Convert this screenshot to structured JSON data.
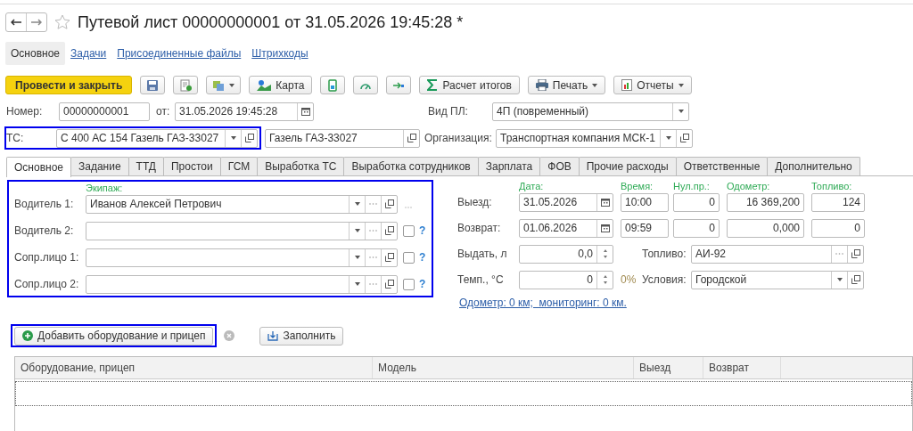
{
  "title": "Путевой лист 00000000001 от 31.05.2026 19:45:28 *",
  "sections": [
    {
      "label": "Основное",
      "selected": true
    },
    {
      "label": "Задачи",
      "selected": false
    },
    {
      "label": "Присоединенные файлы",
      "selected": false
    },
    {
      "label": "Штрихкоды",
      "selected": false
    }
  ],
  "toolbar": {
    "post_close": "Провести и закрыть",
    "map": "Карта",
    "totals": "Расчет итогов",
    "print": "Печать",
    "reports": "Отчеты"
  },
  "number": {
    "label": "Номер:",
    "value": "00000000001"
  },
  "date": {
    "label": "от:",
    "value": "31.05.2026 19:45:28"
  },
  "pl_type": {
    "label": "Вид ПЛ:",
    "value": "4П (повременный)"
  },
  "vehicle": {
    "label": "ТС:",
    "value": "С 400 АС 154 Газель ГАЗ-33027"
  },
  "vehicle_model": {
    "value": "Газель ГАЗ-33027"
  },
  "organization": {
    "label": "Организация:",
    "value": "Транспортная компания МСК-1"
  },
  "tabs": [
    {
      "label": "Основное",
      "selected": true
    },
    {
      "label": "Задание",
      "selected": false
    },
    {
      "label": "ТТД",
      "selected": false
    },
    {
      "label": "Простои",
      "selected": false
    },
    {
      "label": "ГСМ",
      "selected": false
    },
    {
      "label": "Выработка ТС",
      "selected": false
    },
    {
      "label": "Выработка сотрудников",
      "selected": false
    },
    {
      "label": "Зарплата",
      "selected": false
    },
    {
      "label": "ФОВ",
      "selected": false
    },
    {
      "label": "Прочие расходы",
      "selected": false
    },
    {
      "label": "Ответственные",
      "selected": false
    },
    {
      "label": "Дополнительно",
      "selected": false
    }
  ],
  "crew": {
    "heading": "Экипаж:",
    "rows": [
      {
        "kind": "main",
        "label": "Водитель 1:",
        "value": "Иванов Алексей Петрович"
      },
      {
        "kind": "check",
        "label": "Водитель 2:",
        "checked": false,
        "help": "?"
      },
      {
        "kind": "check",
        "label": "Сопр.лицо 1:",
        "checked": false,
        "help": "?"
      },
      {
        "kind": "check",
        "label": "Сопр.лицо 2:",
        "checked": false,
        "help": "?"
      }
    ]
  },
  "trip": {
    "headings": [
      "Дата:",
      "Время:",
      "Нул.пр.:",
      "Одометр:",
      "Топливо:"
    ],
    "rows": [
      {
        "label": "Выезд:",
        "date": "31.05.2026",
        "time": "10:00",
        "zero": "0",
        "odometer": "16 369,200",
        "fuel": "124"
      },
      {
        "label": "Возврат:",
        "date": "01.06.2026",
        "time": "09:59",
        "zero": "0",
        "odometer": "0,000",
        "fuel": "0"
      }
    ]
  },
  "issue": {
    "label": "Выдать, л",
    "value": "0,0"
  },
  "temp": {
    "label": "Темп., °С",
    "value": "0",
    "percent": "0%"
  },
  "fuel_type": {
    "label": "Топливо:",
    "value": "АИ-92"
  },
  "conditions": {
    "label": "Условия:",
    "value": "Городской"
  },
  "odometer_link": "Одометр: 0 км;  мониторинг: 0 км.",
  "equipment": {
    "add_button": "Добавить оборудование и прицеп",
    "fill_button": "Заполнить",
    "columns": [
      "Оборудование, прицеп",
      "Модель",
      "Выезд",
      "Возврат"
    ]
  }
}
